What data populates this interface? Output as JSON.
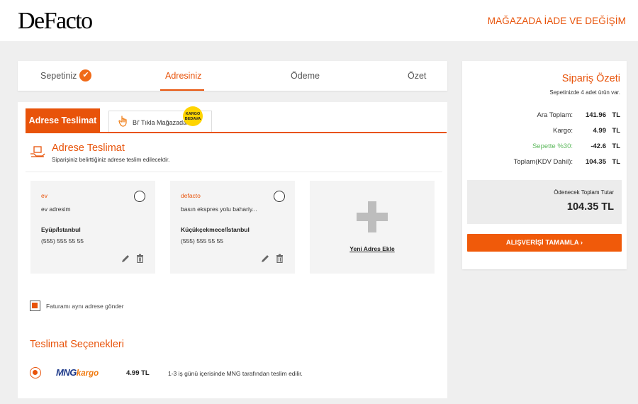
{
  "header": {
    "logo": "DeFacto",
    "store_link": "MAĞAZADA İADE VE DEĞİŞİM"
  },
  "steps": [
    {
      "label": "Sepetiniz",
      "done": true
    },
    {
      "label": "Adresiniz",
      "active": true
    },
    {
      "label": "Ödeme"
    },
    {
      "label": "Özet"
    }
  ],
  "tabs": {
    "home_delivery": "Adrese Teslimat",
    "store_pickup": "Bi' Tıkla Mağazada",
    "badge_line1": "KARGO",
    "badge_line2": "BEDAVA"
  },
  "address_section": {
    "title": "Adrese Teslimat",
    "subtitle": "Siparişiniz belirttiğiniz adrese teslim edilecektir."
  },
  "addresses": [
    {
      "name": "ev",
      "address": "ev adresim",
      "city": "Eyüp/İstanbul",
      "phone": "(555) 555 55 55"
    },
    {
      "name": "defacto",
      "address": "basın ekspres yolu bahariy...",
      "city": "Küçükçekmece/İstanbul",
      "phone": "(555) 555 55 55"
    }
  ],
  "add_address": "Yeni Adres Ekle",
  "invoice_same": "Faturamı aynı adrese gönder",
  "delivery": {
    "title": "Teslimat Seçenekleri",
    "carrier_brand_1": "MNG",
    "carrier_brand_2": "kargo",
    "price": "4.99 TL",
    "description": "1-3 iş günü içerisinde MNG tarafından teslim edilir."
  },
  "summary": {
    "title": "Sipariş Özeti",
    "count_text": "Sepetinizde 4 adet ürün var.",
    "rows": [
      {
        "label": "Ara Toplam:",
        "value": "141.96",
        "currency": "TL"
      },
      {
        "label": "Kargo:",
        "value": "4.99",
        "currency": "TL"
      },
      {
        "label": "Sepette %30:",
        "value": "-42.6",
        "currency": "TL"
      },
      {
        "label": "Toplam(KDV Dahil):",
        "value": "104.35",
        "currency": "TL"
      }
    ],
    "pay_label": "Ödenecek Toplam Tutar",
    "pay_value": "104.35  TL",
    "complete_button": "ALIŞVERİŞİ TAMAMLA  ›"
  },
  "colors": {
    "accent": "#e8530a",
    "green": "#5cb85c",
    "mng_blue": "#1e3a8a",
    "badge_yellow": "#ffd400"
  }
}
